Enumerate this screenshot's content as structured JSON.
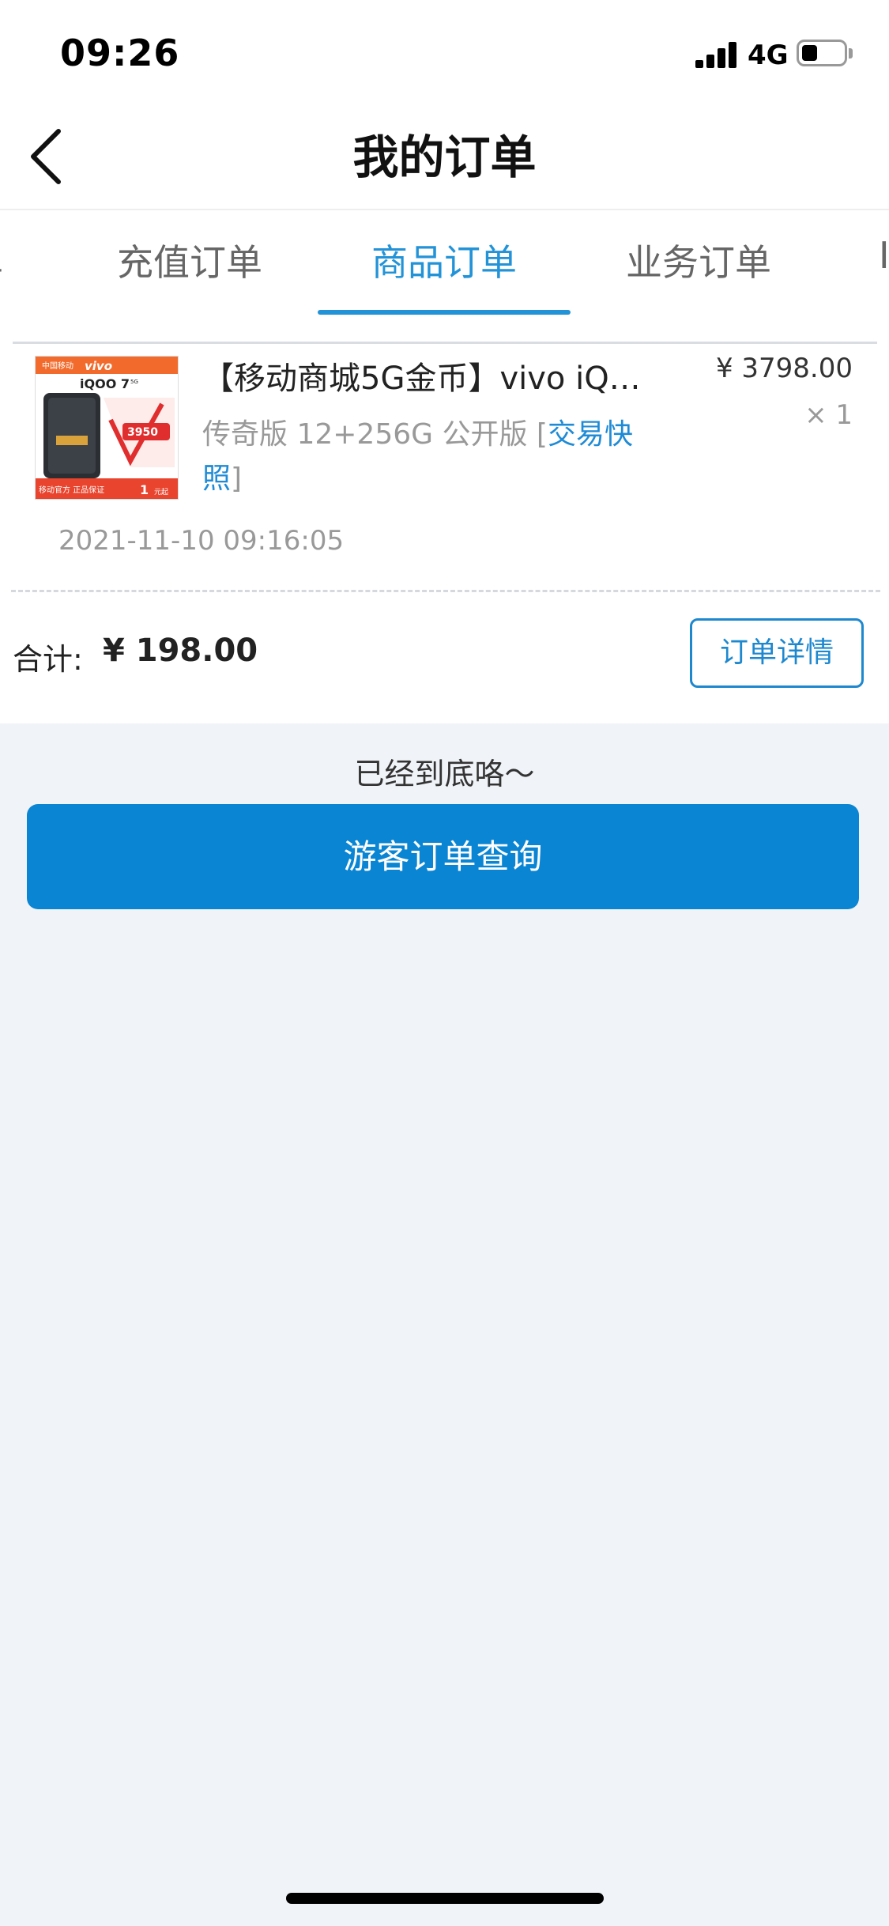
{
  "status_bar": {
    "time": "09:26",
    "network": "4G"
  },
  "nav": {
    "title": "我的订单"
  },
  "tabs": [
    {
      "label": "单",
      "active": false
    },
    {
      "label": "充值订单",
      "active": false
    },
    {
      "label": "商品订单",
      "active": true
    },
    {
      "label": "业务订单",
      "active": false
    },
    {
      "label": "ID",
      "active": false
    }
  ],
  "thumbnail": {
    "brand_left": "中国移动",
    "brand_right": "vivo",
    "model": "iQOO 7",
    "model_suffix": "5G",
    "badge_price": "3950",
    "bottom_left": "移动官方 正品保证",
    "bottom_num": "1",
    "bottom_unit": "元起"
  },
  "order": {
    "title": "【移动商城5G金币】vivo iQ…",
    "price": "¥ 3798.00",
    "quantity": "× 1",
    "spec_prefix": "传奇版  12+256G  公开版  [",
    "spec_link": "交易快照",
    "spec_suffix": "]",
    "time": "2021-11-10 09:16:05"
  },
  "summary": {
    "total_label": "合计:",
    "total_amount": "¥ 198.00",
    "detail_button": "订单详情"
  },
  "footer": {
    "end_text": "已经到底咯～",
    "guest_button": "游客订单查询"
  }
}
